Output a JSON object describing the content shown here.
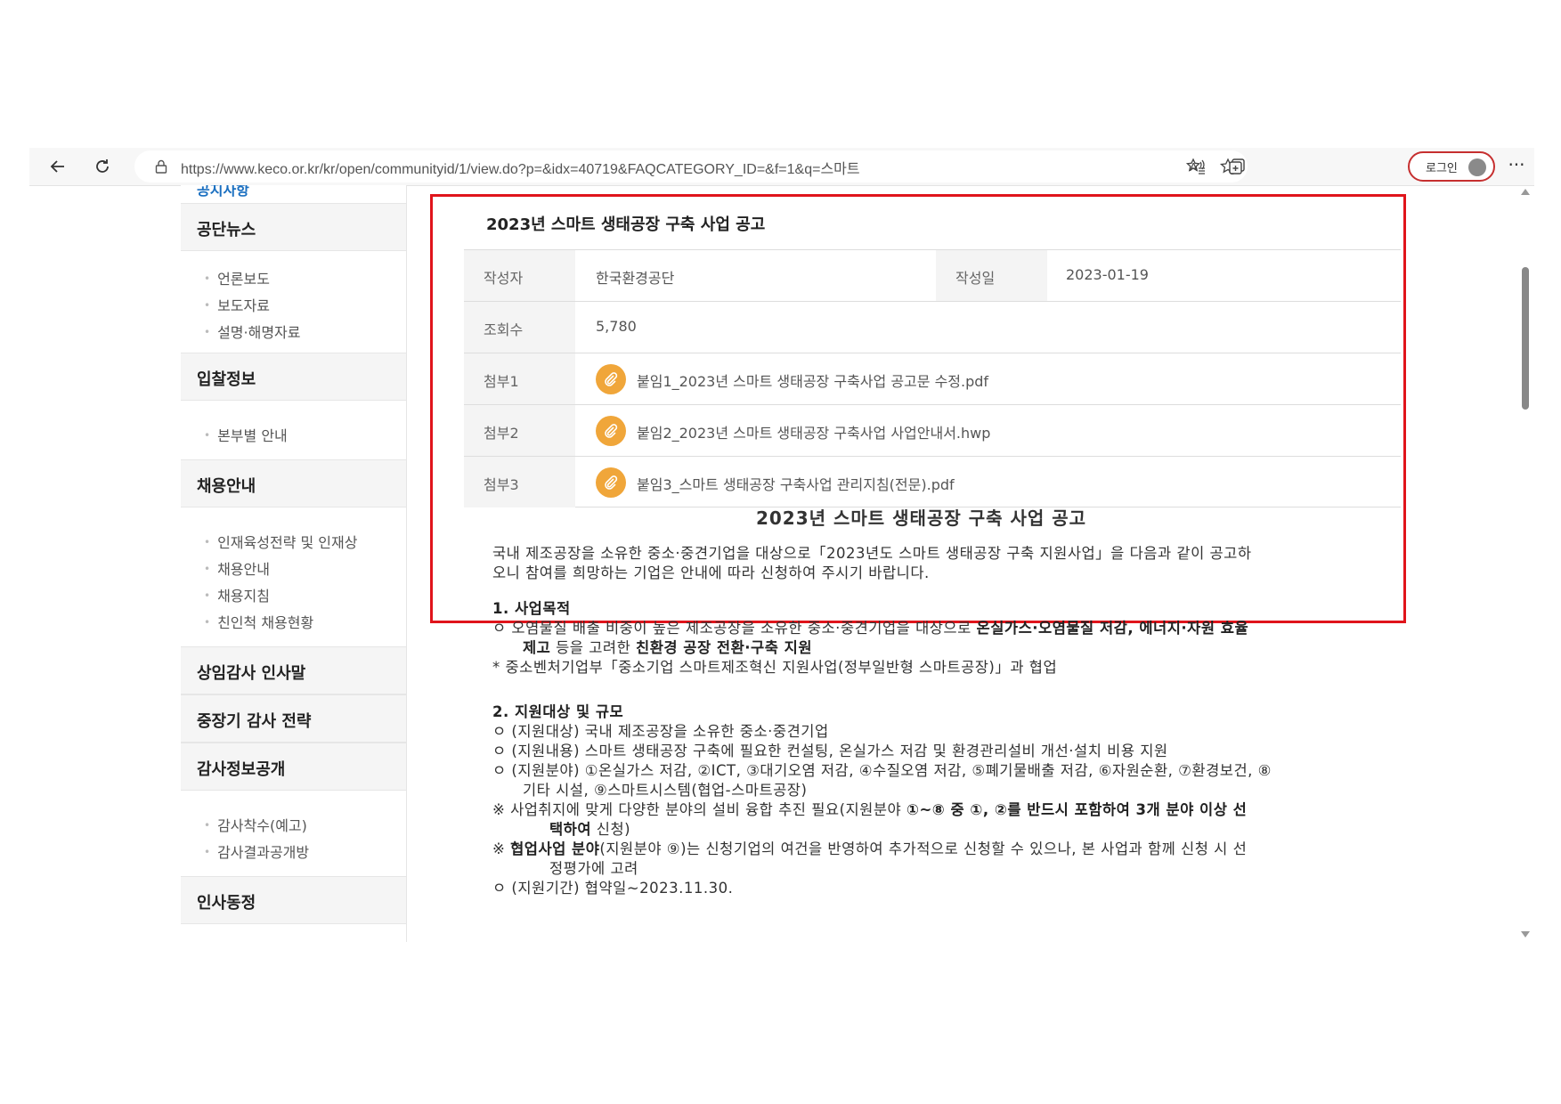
{
  "browser": {
    "url": "https://www.keco.or.kr/kr/open/communityid/1/view.do?p=&idx=40719&FAQCATEGORY_ID=&f=1&q=스마트",
    "login_label": "로그인",
    "more_label": "···"
  },
  "sidebar": {
    "top_partial": "공지사항",
    "groups": [
      {
        "title": "공단뉴스",
        "items": [
          "언론보도",
          "보도자료",
          "설명·해명자료"
        ]
      },
      {
        "title": "입찰정보",
        "items": [
          "본부별 안내"
        ]
      },
      {
        "title": "채용안내",
        "items": [
          "인재육성전략 및 인재상",
          "채용안내",
          "채용지침",
          "친인척 채용현황"
        ]
      },
      {
        "title": "상임감사 인사말",
        "items": []
      },
      {
        "title": "중장기 감사 전략",
        "items": []
      },
      {
        "title": "감사정보공개",
        "items": [
          "감사착수(예고)",
          "감사결과공개방"
        ]
      },
      {
        "title": "인사동정",
        "items": []
      }
    ]
  },
  "post": {
    "title": "2023년 스마트 생태공장 구축 사업 공고",
    "author_label": "작성자",
    "author": "한국환경공단",
    "date_label": "작성일",
    "date": "2023-01-19",
    "views_label": "조회수",
    "views": "5,780",
    "attachments": [
      {
        "label": "첨부1",
        "file": "붙임1_2023년 스마트 생태공장 구축사업 공고문 수정.pdf"
      },
      {
        "label": "첨부2",
        "file": "붙임2_2023년 스마트 생태공장 구축사업 사업안내서.hwp"
      },
      {
        "label": "첨부3",
        "file": "붙임3_스마트 생태공장 구축사업 관리지침(전문).pdf"
      }
    ]
  },
  "doc": {
    "heading": "2023년 스마트 생태공장 구축 사업 공고",
    "intro1": "국내 제조공장을 소유한 중소·중견기업을 대상으로「2023년도 스마트 생태공장 구축 지원사업」을 다음과 같이 공고하",
    "intro2": "오니 참여를 희망하는 기업은 안내에 따라 신청하여 주시기 바랍니다.",
    "s1_title": "1. 사업목적",
    "s1_l1_a": "ㅇ 오염물질 배출 비중이 높은 제조공장을 소유한 중소·중견기업을 대상으로 ",
    "s1_l1_b": "온실가스·오염물질 저감, 에너지·자원 효율",
    "s1_l2_a": "제고",
    "s1_l2_b": " 등을 고려한 ",
    "s1_l2_c": "친환경 공장 전환·구축 지원",
    "s1_l3": "* 중소벤처기업부「중소기업 스마트제조혁신 지원사업(정부일반형 스마트공장)」과 협업",
    "s2_title": "2. 지원대상 및 규모",
    "s2_l1": "ㅇ (지원대상) 국내 제조공장을 소유한 중소·중견기업",
    "s2_l2": "ㅇ (지원내용) 스마트 생태공장 구축에 필요한 컨설팅, 온실가스 저감 및 환경관리설비 개선·설치 비용 지원",
    "s2_l3": "ㅇ (지원분야) ①온실가스 저감, ②ICT, ③대기오염 저감, ④수질오염 저감, ⑤폐기물배출 저감, ⑥자원순환, ⑦환경보건, ⑧",
    "s2_l4": "기타 시설, ⑨스마트시스템(협업-스마트공장)",
    "s2_l5_a": "※ 사업취지에 맞게 다양한 분야의 설비 융합 추진 필요(지원분야 ",
    "s2_l5_b": "①~⑧ 중 ①, ②를 반드시 포함하여 3개 분야 이상 선",
    "s2_l6_a": "택하여",
    "s2_l6_b": " 신청)",
    "s2_l7_a": "※ ",
    "s2_l7_b": "협업사업 분야",
    "s2_l7_c": "(지원분야 ⑨)는 신청기업의 여건을 반영하여 추가적으로 신청할 수 있으나, 본 사업과 함께 신청 시 선",
    "s2_l8": "정평가에 고려",
    "s2_l9": "ㅇ (지원기간) 협약일~2023.11.30."
  }
}
